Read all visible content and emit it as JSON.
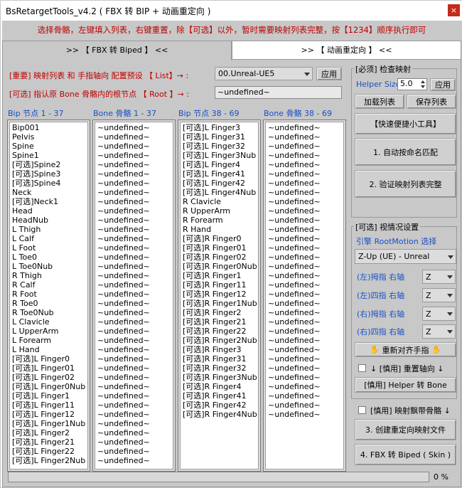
{
  "window": {
    "title": "BsRetargetTools_v4.2   ( FBX 转 BIP + 动画重定向 )",
    "close_label": "×"
  },
  "hint": "选择骨骼，左键填入列表，右键重置，除【可选】以外，暂时需要映射列表完整，按【1234】顺序执行即可",
  "tabs": [
    ">> 【 FBX 转 Biped 】 <<",
    ">> 【 动画重定向 】 <<"
  ],
  "preset": {
    "label": "[重要] 映射列表 和 手指轴向 配置预设 【 List】→ :",
    "value": "00.Unreal-UE5",
    "apply": "应用"
  },
  "root": {
    "label": "[可选] 指认原 Bone 骨骼内的根节点 【 Root 】→ :",
    "value": "~undefined~"
  },
  "lists": {
    "h1": "Bip 节点 1 - 37",
    "h2": "Bone 骨骼 1 - 37",
    "h3": "Bip 节点 38 - 69",
    "h4": "Bone 骨骼 38 - 69",
    "bip1": [
      "Bip001",
      "Pelvis",
      "Spine",
      "Spine1",
      "[可选]Spine2",
      "[可选]Spine3",
      "[可选]Spine4",
      "Neck",
      "[可选]Neck1",
      "Head",
      "HeadNub",
      "L Thigh",
      "L Calf",
      "L Foot",
      "L Toe0",
      "L Toe0Nub",
      "R Thigh",
      "R Calf",
      "R Foot",
      "R Toe0",
      "R Toe0Nub",
      "L Clavicle",
      "L UpperArm",
      "L Forearm",
      "L Hand",
      "[可选]L Finger0",
      "[可选]L Finger01",
      "[可选]L Finger02",
      "[可选]L Finger0Nub",
      "[可选]L Finger1",
      "[可选]L Finger11",
      "[可选]L Finger12",
      "[可选]L Finger1Nub",
      "[可选]L Finger2",
      "[可选]L Finger21",
      "[可选]L Finger22",
      "[可选]L Finger2Nub"
    ],
    "bone1": [
      "~undefined~",
      "~undefined~",
      "~undefined~",
      "~undefined~",
      "~undefined~",
      "~undefined~",
      "~undefined~",
      "~undefined~",
      "~undefined~",
      "~undefined~",
      "~undefined~",
      "~undefined~",
      "~undefined~",
      "~undefined~",
      "~undefined~",
      "~undefined~",
      "~undefined~",
      "~undefined~",
      "~undefined~",
      "~undefined~",
      "~undefined~",
      "~undefined~",
      "~undefined~",
      "~undefined~",
      "~undefined~",
      "~undefined~",
      "~undefined~",
      "~undefined~",
      "~undefined~",
      "~undefined~",
      "~undefined~",
      "~undefined~",
      "~undefined~",
      "~undefined~",
      "~undefined~",
      "~undefined~",
      "~undefined~"
    ],
    "bip2": [
      "[可选]L Finger3",
      "[可选]L Finger31",
      "[可选]L Finger32",
      "[可选]L Finger3Nub",
      "[可选]L Finger4",
      "[可选]L Finger41",
      "[可选]L Finger42",
      "[可选]L Finger4Nub",
      "R Clavicle",
      "R UpperArm",
      "R Forearm",
      "R Hand",
      "[可选]R Finger0",
      "[可选]R Finger01",
      "[可选]R Finger02",
      "[可选]R Finger0Nub",
      "[可选]R Finger1",
      "[可选]R Finger11",
      "[可选]R Finger12",
      "[可选]R Finger1Nub",
      "[可选]R Finger2",
      "[可选]R Finger21",
      "[可选]R Finger22",
      "[可选]R Finger2Nub",
      "[可选]R Finger3",
      "[可选]R Finger31",
      "[可选]R Finger32",
      "[可选]R Finger3Nub",
      "[可选]R Finger4",
      "[可选]R Finger41",
      "[可选]R Finger42",
      "[可选]R Finger4Nub"
    ],
    "bone2": [
      "~undefined~",
      "~undefined~",
      "~undefined~",
      "~undefined~",
      "~undefined~",
      "~undefined~",
      "~undefined~",
      "~undefined~",
      "~undefined~",
      "~undefined~",
      "~undefined~",
      "~undefined~",
      "~undefined~",
      "~undefined~",
      "~undefined~",
      "~undefined~",
      "~undefined~",
      "~undefined~",
      "~undefined~",
      "~undefined~",
      "~undefined~",
      "~undefined~",
      "~undefined~",
      "~undefined~",
      "~undefined~",
      "~undefined~",
      "~undefined~",
      "~undefined~",
      "~undefined~",
      "~undefined~",
      "~undefined~",
      "~undefined~"
    ]
  },
  "check": {
    "title": "[必须] 检查映射",
    "helper_label": "Helper Size",
    "helper_value": "5.0",
    "apply": "应用",
    "load": "加载列表",
    "save": "保存列表",
    "quick": "【快速便捷小工具】",
    "auto": "1. 自动按命名匹配",
    "verify": "2. 验证映射列表完整"
  },
  "optional": {
    "title": "[可选] 视情况设置",
    "engine": "引擎 RootMotion 选择",
    "engine_value": "Z-Up (UE)  - Unreal",
    "axes": [
      {
        "label": "(左)拇指 右轴",
        "value": "Z"
      },
      {
        "label": "(左)四指 右轴",
        "value": "Z"
      },
      {
        "label": "(右)拇指 右轴",
        "value": "Z"
      },
      {
        "label": "(右)四指 右轴",
        "value": "Z"
      }
    ],
    "realign": "重新对齐手指",
    "reset_axis": "↓ [慎用] 重置轴向 ↓",
    "helper_bone": "[慎用] Helper 转 Bone"
  },
  "bottom": {
    "map_bone": "[慎用] 映射飘带骨骼 ↓",
    "create": "3. 创建重定向映射文件",
    "convert": "4. FBX 转 Biped ( Skin )"
  },
  "progress": {
    "value": 0,
    "text": "0 %"
  },
  "colors": {
    "accent_red": "#c00000",
    "accent_blue": "#1a4fc4",
    "close": "#c42b1c"
  }
}
